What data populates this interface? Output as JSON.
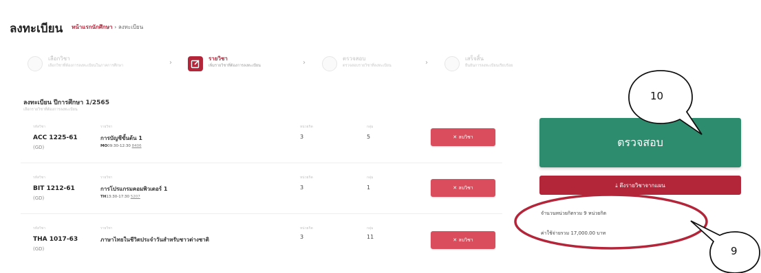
{
  "page": {
    "title": "ลงทะเบียน",
    "breadcrumb": {
      "home": "หน้าแรกนักศึกษา",
      "separator": "›",
      "current": "ลงทะเบียน"
    }
  },
  "stepper": {
    "separator": "›",
    "steps": [
      {
        "name": "เลือกวิชา",
        "desc": "เลือกวิชาที่ต้องการลงทะเบียนในภาคการศึกษา",
        "state": "done"
      },
      {
        "name": "รายวิชา",
        "desc": "เพิ่มรายวิชาที่ต้องการลงทะเบียน",
        "state": "active",
        "icon": "edit-icon"
      },
      {
        "name": "ตรวจสอบ",
        "desc": "ตรวจสอบรายวิชาที่ลงทะเบียน",
        "state": "pending"
      },
      {
        "name": "เสร็จสิ้น",
        "desc": "ยืนยันการลงทะเบียนเรียบร้อย",
        "state": "pending"
      }
    ]
  },
  "section": {
    "title": "ลงทะเบียน ปีการศึกษา 1/2565",
    "subtitle": "เลือกรายวิชาที่ต้องการลงทะเบียน"
  },
  "columns": {
    "code": "รหัสวิชา",
    "name": "รายวิชา",
    "credits": "หน่วยกิต",
    "section": "กลุ่ม"
  },
  "courses": [
    {
      "code": "ACC 1225-61",
      "category": "(GD)",
      "name": "การบัญชีขั้นต้น 1",
      "day": "MO",
      "time": "09:30-12:30",
      "room": "8406",
      "credits": "3",
      "section": "5",
      "drop_label": "✕ ลบวิชา"
    },
    {
      "code": "BIT 1212-61",
      "category": "(GD)",
      "name": "การโปรแกรมคอมพิวเตอร์ 1",
      "day": "TH",
      "time": "13:30-17:30",
      "room": "5207",
      "credits": "3",
      "section": "1",
      "drop_label": "✕ ลบวิชา"
    },
    {
      "code": "THA 1017-63",
      "category": "(GD)",
      "name": "ภาษาไทยในชีวิตประจำวันสำหรับชาวต่างชาติ",
      "day": "",
      "time": "",
      "room": "",
      "credits": "3",
      "section": "11",
      "drop_label": "✕ ลบวิชา"
    }
  ],
  "actions": {
    "check_label": "ตรวจสอบ",
    "pull_label": "⤓ ดึงรายวิชาจากแผน"
  },
  "summary": {
    "credits_text": "จำนวนหน่วยกิตรวม 9 หน่วยกิต",
    "fee_text": "ค่าใช้จ่ายรวม 17,000.00 บาท"
  },
  "annotations": {
    "callout_10": "10",
    "callout_9": "9",
    "color": "#b3263a"
  },
  "colors": {
    "accent": "#b3263a",
    "check_button": "#2e8c6e",
    "drop_button": "#d94d5d"
  }
}
